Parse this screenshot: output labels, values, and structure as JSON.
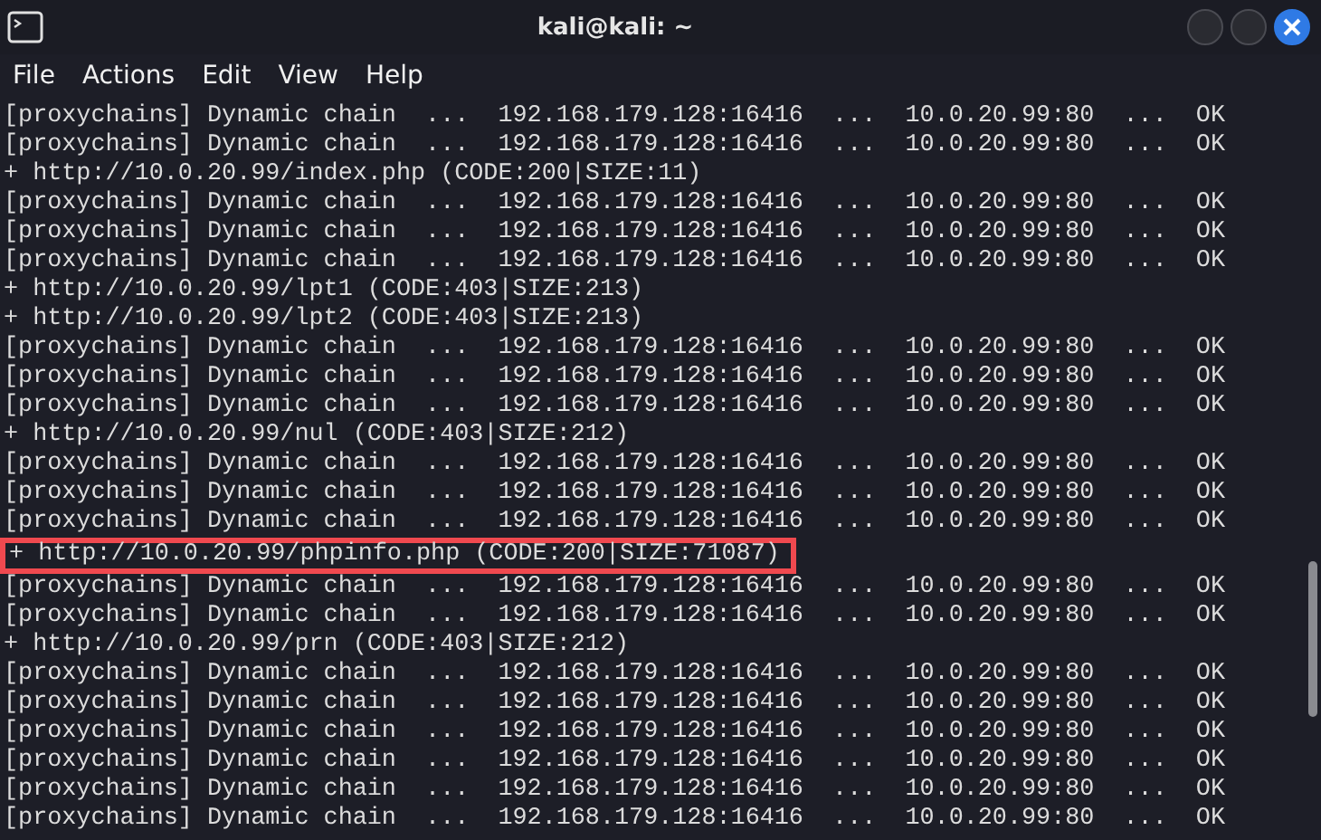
{
  "window": {
    "title": "kali@kali: ~"
  },
  "menu": [
    "File",
    "Actions",
    "Edit",
    "View",
    "Help"
  ],
  "lines": [
    {
      "text": "[proxychains] Dynamic chain  ...  192.168.179.128:16416  ...  10.0.20.99:80  ...  OK",
      "highlighted": false
    },
    {
      "text": "[proxychains] Dynamic chain  ...  192.168.179.128:16416  ...  10.0.20.99:80  ...  OK",
      "highlighted": false
    },
    {
      "text": "+ http://10.0.20.99/index.php (CODE:200|SIZE:11)",
      "highlighted": false
    },
    {
      "text": "[proxychains] Dynamic chain  ...  192.168.179.128:16416  ...  10.0.20.99:80  ...  OK",
      "highlighted": false
    },
    {
      "text": "[proxychains] Dynamic chain  ...  192.168.179.128:16416  ...  10.0.20.99:80  ...  OK",
      "highlighted": false
    },
    {
      "text": "[proxychains] Dynamic chain  ...  192.168.179.128:16416  ...  10.0.20.99:80  ...  OK",
      "highlighted": false
    },
    {
      "text": "+ http://10.0.20.99/lpt1 (CODE:403|SIZE:213)",
      "highlighted": false
    },
    {
      "text": "+ http://10.0.20.99/lpt2 (CODE:403|SIZE:213)",
      "highlighted": false
    },
    {
      "text": "[proxychains] Dynamic chain  ...  192.168.179.128:16416  ...  10.0.20.99:80  ...  OK",
      "highlighted": false
    },
    {
      "text": "[proxychains] Dynamic chain  ...  192.168.179.128:16416  ...  10.0.20.99:80  ...  OK",
      "highlighted": false
    },
    {
      "text": "[proxychains] Dynamic chain  ...  192.168.179.128:16416  ...  10.0.20.99:80  ...  OK",
      "highlighted": false
    },
    {
      "text": "+ http://10.0.20.99/nul (CODE:403|SIZE:212)",
      "highlighted": false
    },
    {
      "text": "[proxychains] Dynamic chain  ...  192.168.179.128:16416  ...  10.0.20.99:80  ...  OK",
      "highlighted": false
    },
    {
      "text": "[proxychains] Dynamic chain  ...  192.168.179.128:16416  ...  10.0.20.99:80  ...  OK",
      "highlighted": false
    },
    {
      "text": "[proxychains] Dynamic chain  ...  192.168.179.128:16416  ...  10.0.20.99:80  ...  OK",
      "highlighted": false
    },
    {
      "text": "+ http://10.0.20.99/phpinfo.php (CODE:200|SIZE:71087)",
      "highlighted": true
    },
    {
      "text": "[proxychains] Dynamic chain  ...  192.168.179.128:16416  ...  10.0.20.99:80  ...  OK",
      "highlighted": false
    },
    {
      "text": "[proxychains] Dynamic chain  ...  192.168.179.128:16416  ...  10.0.20.99:80  ...  OK",
      "highlighted": false
    },
    {
      "text": "+ http://10.0.20.99/prn (CODE:403|SIZE:212)",
      "highlighted": false
    },
    {
      "text": "[proxychains] Dynamic chain  ...  192.168.179.128:16416  ...  10.0.20.99:80  ...  OK",
      "highlighted": false
    },
    {
      "text": "[proxychains] Dynamic chain  ...  192.168.179.128:16416  ...  10.0.20.99:80  ...  OK",
      "highlighted": false
    },
    {
      "text": "[proxychains] Dynamic chain  ...  192.168.179.128:16416  ...  10.0.20.99:80  ...  OK",
      "highlighted": false
    },
    {
      "text": "[proxychains] Dynamic chain  ...  192.168.179.128:16416  ...  10.0.20.99:80  ...  OK",
      "highlighted": false
    },
    {
      "text": "[proxychains] Dynamic chain  ...  192.168.179.128:16416  ...  10.0.20.99:80  ...  OK",
      "highlighted": false
    },
    {
      "text": "[proxychains] Dynamic chain  ...  192.168.179.128:16416  ...  10.0.20.99:80  ...  OK",
      "highlighted": false
    }
  ]
}
